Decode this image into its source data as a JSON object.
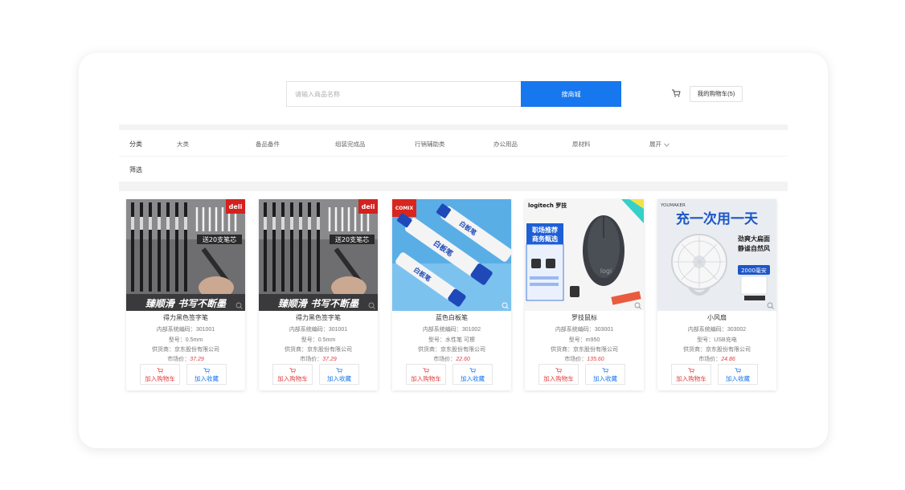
{
  "search": {
    "placeholder": "请输入商品名称",
    "button_label": "搜商城"
  },
  "cart": {
    "label": "我的购物车(5)"
  },
  "filters": {
    "category_label": "分类",
    "categories": [
      "大类",
      "备品备件",
      "组装完成品",
      "行销辅助类",
      "办公用品",
      "原材料"
    ],
    "expand_label": "展开",
    "screen_label": "筛选"
  },
  "labels": {
    "sku": "内部系统编码：",
    "model": "型号：",
    "supplier": "供货商：",
    "price": "市场价：",
    "add_cart": "加入购物车",
    "add_fav": "加入收藏"
  },
  "products": [
    {
      "name": "得力黑色签字笔",
      "sku": "301001",
      "model": "0.5mm",
      "supplier": "京东股份有限公司",
      "price": "37.29",
      "img": {
        "brand": "deli",
        "badge": "送20支笔芯",
        "slogan": "臻顺滑 书写不断墨"
      }
    },
    {
      "name": "得力黑色签字笔",
      "sku": "301001",
      "model": "0.5mm",
      "supplier": "京东股份有限公司",
      "price": "37.29",
      "img": {
        "brand": "deli",
        "badge": "送20支笔芯",
        "slogan": "臻顺滑 书写不断墨"
      }
    },
    {
      "name": "蓝色白板笔",
      "sku": "301002",
      "model": "水性笔 可擦",
      "supplier": "京东股份有限公司",
      "price": "22.60",
      "img": {
        "brand": "COMIX",
        "marker_text": "白板笔"
      }
    },
    {
      "name": "罗技鼠标",
      "sku": "303001",
      "model": "m950",
      "supplier": "京东股份有限公司",
      "price": "135.60",
      "img": {
        "brand": "logitech 罗技",
        "headline1": "职场推荐",
        "headline2": "商务甄选",
        "mouse_logo": "logi"
      }
    },
    {
      "name": "小风扇",
      "sku": "303002",
      "model": "USB充电",
      "supplier": "京东股份有限公司",
      "price": "24.86",
      "img": {
        "brand": "YOUMAKER",
        "headline": "充一次用一天",
        "sub1": "劲爽大扁面",
        "sub2": "静谧自然风",
        "badge": "2000毫安"
      }
    }
  ]
}
